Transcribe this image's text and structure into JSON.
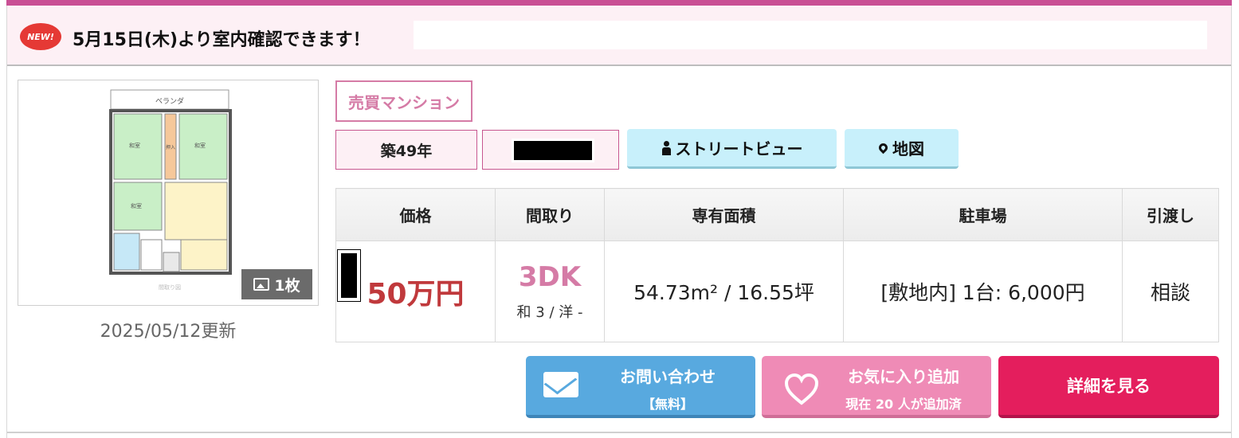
{
  "notice": {
    "badge": "NEW!",
    "text": "5月15日(木)より室内確認できます！"
  },
  "photo": {
    "count_label": "1枚",
    "updated": "2025/05/12更新"
  },
  "tags": {
    "property_type": "売買マンション",
    "age": "築49年",
    "street_view": "ストリートビュー",
    "map": "地図"
  },
  "table": {
    "headers": [
      "価格",
      "間取り",
      "専有面積",
      "駐車場",
      "引渡し"
    ],
    "price": "50万円",
    "layout": "3DK",
    "layout_detail": "和 3 / 洋 -",
    "area": "54.73m² / 16.55坪",
    "parking": "[敷地内] 1台: 6,000円",
    "handover": "相談"
  },
  "actions": {
    "inquiry_main": "お問い合わせ",
    "inquiry_sub": "【無料】",
    "favorite_main": "お気に入り追加",
    "favorite_sub": "現在 20 人が追加済",
    "detail": "詳細を見る"
  },
  "colors": {
    "accent_pink": "#c94f94",
    "price_red": "#c0393c",
    "inquiry_blue": "#58a9df",
    "favorite_pink": "#ef8bb6",
    "detail_red": "#e41e5d"
  }
}
